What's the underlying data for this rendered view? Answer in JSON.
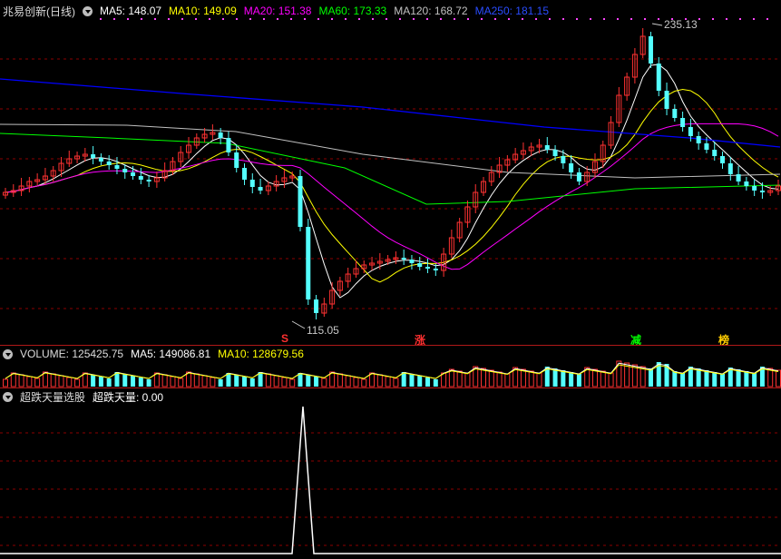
{
  "main_header": {
    "title": "兆易创新(日线)",
    "ma5": "MA5: 148.07",
    "ma10": "MA10: 149.09",
    "ma20": "MA20: 151.38",
    "ma60": "MA60: 173.33",
    "ma120": "MA120: 168.72",
    "ma250": "MA250: 181.15"
  },
  "colors": {
    "ma5": "#ffffff",
    "ma10": "#ffff00",
    "ma20": "#ff00ff",
    "ma60": "#00ff00",
    "ma120": "#c0c0c0",
    "ma250": "#0000ff",
    "up": "#ff3232",
    "down": "#54ffff",
    "grid": "#8b0000"
  },
  "annotations": {
    "high": "235.13",
    "low": "115.05"
  },
  "signals": [
    "S",
    "涨",
    "减",
    "榜"
  ],
  "volume_header": {
    "label": "VOLUME: 125425.75",
    "ma5": "MA5: 149086.81",
    "ma10": "MA10: 128679.56"
  },
  "indicator_header": {
    "label": "超跌天量选股",
    "value": "超跌天量: 0.00"
  },
  "chart_data": {
    "type": "candlestick",
    "symbol": "兆易创新",
    "period": "日线",
    "high_label": 235.13,
    "low_label": 115.05,
    "ma_last": {
      "MA5": 148.07,
      "MA10": 149.09,
      "MA20": 151.38,
      "MA60": 173.33,
      "MA120": 168.72,
      "MA250": 181.15
    },
    "volume_last": 125425.75,
    "volume_ma5": 149086.81,
    "volume_ma10": 128679.56,
    "indicator_last": 0.0
  }
}
